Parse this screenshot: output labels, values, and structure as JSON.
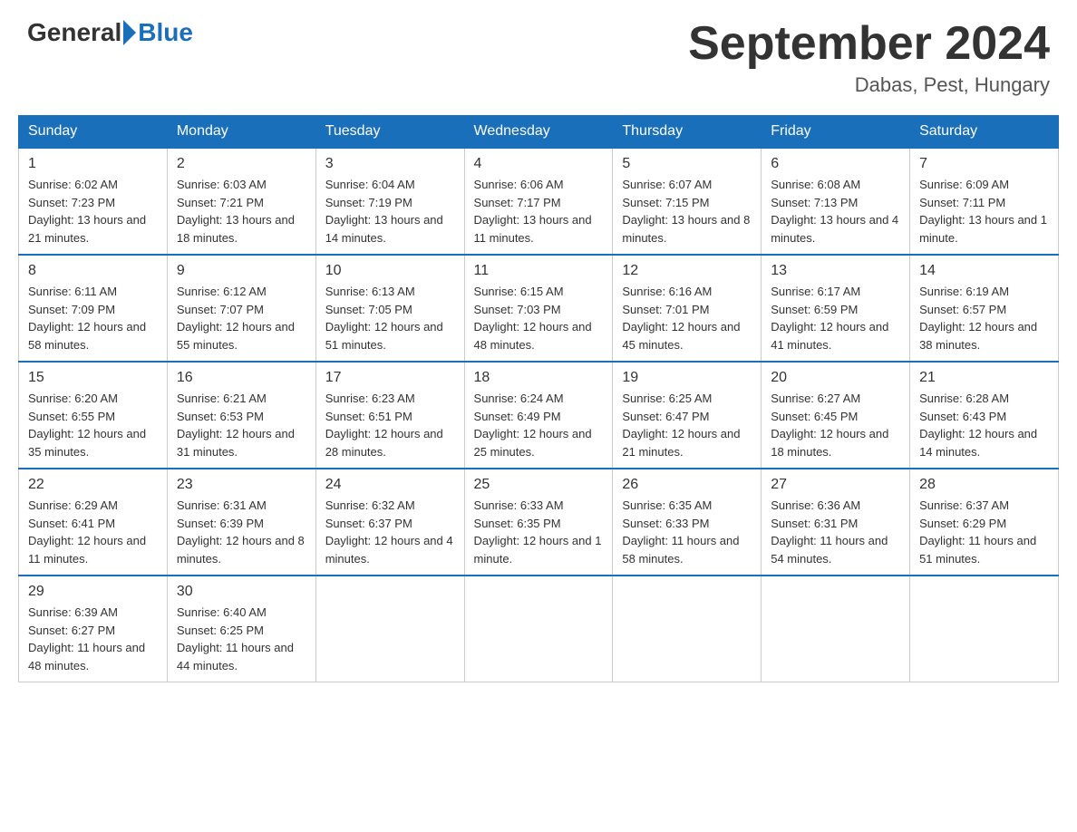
{
  "header": {
    "logo_general": "General",
    "logo_blue": "Blue",
    "month_title": "September 2024",
    "location": "Dabas, Pest, Hungary"
  },
  "calendar": {
    "days_of_week": [
      "Sunday",
      "Monday",
      "Tuesday",
      "Wednesday",
      "Thursday",
      "Friday",
      "Saturday"
    ],
    "weeks": [
      [
        {
          "day": "1",
          "sunrise": "6:02 AM",
          "sunset": "7:23 PM",
          "daylight": "13 hours and 21 minutes."
        },
        {
          "day": "2",
          "sunrise": "6:03 AM",
          "sunset": "7:21 PM",
          "daylight": "13 hours and 18 minutes."
        },
        {
          "day": "3",
          "sunrise": "6:04 AM",
          "sunset": "7:19 PM",
          "daylight": "13 hours and 14 minutes."
        },
        {
          "day": "4",
          "sunrise": "6:06 AM",
          "sunset": "7:17 PM",
          "daylight": "13 hours and 11 minutes."
        },
        {
          "day": "5",
          "sunrise": "6:07 AM",
          "sunset": "7:15 PM",
          "daylight": "13 hours and 8 minutes."
        },
        {
          "day": "6",
          "sunrise": "6:08 AM",
          "sunset": "7:13 PM",
          "daylight": "13 hours and 4 minutes."
        },
        {
          "day": "7",
          "sunrise": "6:09 AM",
          "sunset": "7:11 PM",
          "daylight": "13 hours and 1 minute."
        }
      ],
      [
        {
          "day": "8",
          "sunrise": "6:11 AM",
          "sunset": "7:09 PM",
          "daylight": "12 hours and 58 minutes."
        },
        {
          "day": "9",
          "sunrise": "6:12 AM",
          "sunset": "7:07 PM",
          "daylight": "12 hours and 55 minutes."
        },
        {
          "day": "10",
          "sunrise": "6:13 AM",
          "sunset": "7:05 PM",
          "daylight": "12 hours and 51 minutes."
        },
        {
          "day": "11",
          "sunrise": "6:15 AM",
          "sunset": "7:03 PM",
          "daylight": "12 hours and 48 minutes."
        },
        {
          "day": "12",
          "sunrise": "6:16 AM",
          "sunset": "7:01 PM",
          "daylight": "12 hours and 45 minutes."
        },
        {
          "day": "13",
          "sunrise": "6:17 AM",
          "sunset": "6:59 PM",
          "daylight": "12 hours and 41 minutes."
        },
        {
          "day": "14",
          "sunrise": "6:19 AM",
          "sunset": "6:57 PM",
          "daylight": "12 hours and 38 minutes."
        }
      ],
      [
        {
          "day": "15",
          "sunrise": "6:20 AM",
          "sunset": "6:55 PM",
          "daylight": "12 hours and 35 minutes."
        },
        {
          "day": "16",
          "sunrise": "6:21 AM",
          "sunset": "6:53 PM",
          "daylight": "12 hours and 31 minutes."
        },
        {
          "day": "17",
          "sunrise": "6:23 AM",
          "sunset": "6:51 PM",
          "daylight": "12 hours and 28 minutes."
        },
        {
          "day": "18",
          "sunrise": "6:24 AM",
          "sunset": "6:49 PM",
          "daylight": "12 hours and 25 minutes."
        },
        {
          "day": "19",
          "sunrise": "6:25 AM",
          "sunset": "6:47 PM",
          "daylight": "12 hours and 21 minutes."
        },
        {
          "day": "20",
          "sunrise": "6:27 AM",
          "sunset": "6:45 PM",
          "daylight": "12 hours and 18 minutes."
        },
        {
          "day": "21",
          "sunrise": "6:28 AM",
          "sunset": "6:43 PM",
          "daylight": "12 hours and 14 minutes."
        }
      ],
      [
        {
          "day": "22",
          "sunrise": "6:29 AM",
          "sunset": "6:41 PM",
          "daylight": "12 hours and 11 minutes."
        },
        {
          "day": "23",
          "sunrise": "6:31 AM",
          "sunset": "6:39 PM",
          "daylight": "12 hours and 8 minutes."
        },
        {
          "day": "24",
          "sunrise": "6:32 AM",
          "sunset": "6:37 PM",
          "daylight": "12 hours and 4 minutes."
        },
        {
          "day": "25",
          "sunrise": "6:33 AM",
          "sunset": "6:35 PM",
          "daylight": "12 hours and 1 minute."
        },
        {
          "day": "26",
          "sunrise": "6:35 AM",
          "sunset": "6:33 PM",
          "daylight": "11 hours and 58 minutes."
        },
        {
          "day": "27",
          "sunrise": "6:36 AM",
          "sunset": "6:31 PM",
          "daylight": "11 hours and 54 minutes."
        },
        {
          "day": "28",
          "sunrise": "6:37 AM",
          "sunset": "6:29 PM",
          "daylight": "11 hours and 51 minutes."
        }
      ],
      [
        {
          "day": "29",
          "sunrise": "6:39 AM",
          "sunset": "6:27 PM",
          "daylight": "11 hours and 48 minutes."
        },
        {
          "day": "30",
          "sunrise": "6:40 AM",
          "sunset": "6:25 PM",
          "daylight": "11 hours and 44 minutes."
        },
        null,
        null,
        null,
        null,
        null
      ]
    ],
    "labels": {
      "sunrise": "Sunrise:",
      "sunset": "Sunset:",
      "daylight": "Daylight:"
    }
  }
}
